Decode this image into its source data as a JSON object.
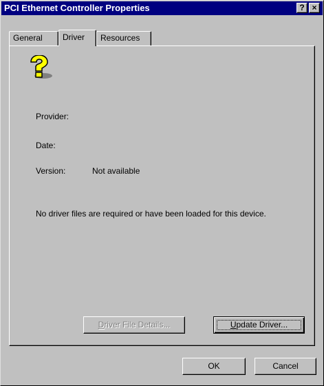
{
  "window": {
    "title": "PCI Ethernet Controller Properties",
    "help_button": "?",
    "close_button": "×"
  },
  "tabs": [
    {
      "label": "General",
      "selected": false
    },
    {
      "label": "Driver",
      "selected": true
    },
    {
      "label": "Resources",
      "selected": false
    }
  ],
  "driver": {
    "icon": "unknown-device-question-icon",
    "provider_label": "Provider:",
    "provider_value": "",
    "date_label": "Date:",
    "date_value": "",
    "version_label": "Version:",
    "version_value": "Not available",
    "message": "No driver files are required or have been loaded for this device.",
    "details_button": {
      "prefix": "",
      "mnemonic": "D",
      "rest": "river File Details...",
      "enabled": false
    },
    "update_button": {
      "prefix": "",
      "mnemonic": "U",
      "rest": "pdate Driver...",
      "enabled": true
    }
  },
  "footer": {
    "ok_label": "OK",
    "cancel_label": "Cancel"
  },
  "colors": {
    "titlebar": "#000080",
    "face": "#c0c0c0",
    "icon_yellow": "#ffff00"
  }
}
